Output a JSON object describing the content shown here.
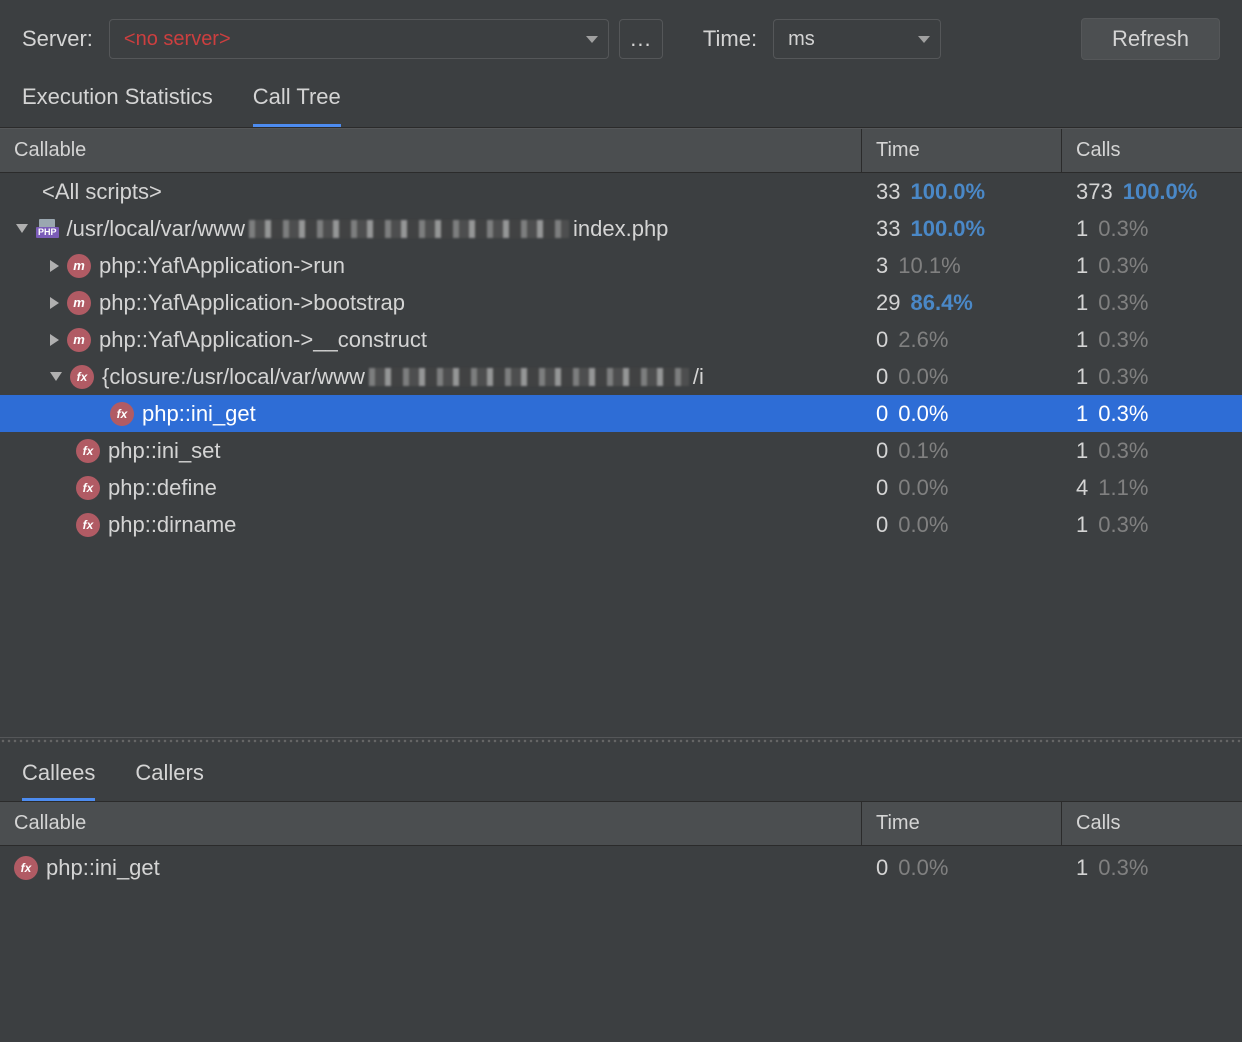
{
  "toolbar": {
    "server_label": "Server:",
    "server_value": "<no server>",
    "ellipsis": "...",
    "time_label": "Time:",
    "time_value": "ms",
    "refresh": "Refresh"
  },
  "tabs": {
    "exec_stats": "Execution Statistics",
    "call_tree": "Call Tree"
  },
  "columns": {
    "callable": "Callable",
    "time": "Time",
    "calls": "Calls"
  },
  "rows": [
    {
      "indent": 0,
      "tri": "none",
      "icon": "none",
      "label": "<All scripts>",
      "time_n": "33",
      "time_p": "100.0%",
      "time_hl": true,
      "calls_n": "373",
      "calls_p": "100.0%",
      "calls_hl": true
    },
    {
      "indent": 0,
      "tri": "open",
      "icon": "php",
      "label_pre": "/usr/local/var/www",
      "label_post": "index.php",
      "blur": true,
      "time_n": "33",
      "time_p": "100.0%",
      "time_hl": true,
      "calls_n": "1",
      "calls_p": "0.3%"
    },
    {
      "indent": 1,
      "tri": "closed",
      "icon": "m",
      "label": "php::Yaf\\Application->run",
      "time_n": "3",
      "time_p": "10.1%",
      "calls_n": "1",
      "calls_p": "0.3%"
    },
    {
      "indent": 1,
      "tri": "closed",
      "icon": "m",
      "label": "php::Yaf\\Application->bootstrap",
      "time_n": "29",
      "time_p": "86.4%",
      "time_hl": true,
      "calls_n": "1",
      "calls_p": "0.3%"
    },
    {
      "indent": 1,
      "tri": "closed",
      "icon": "m",
      "label": "php::Yaf\\Application->__construct",
      "time_n": "0",
      "time_p": "2.6%",
      "calls_n": "1",
      "calls_p": "0.3%"
    },
    {
      "indent": 1,
      "tri": "open",
      "icon": "fx",
      "label_pre": "{closure:/usr/local/var/www",
      "label_post": "/i",
      "blur": true,
      "time_n": "0",
      "time_p": "0.0%",
      "calls_n": "1",
      "calls_p": "0.3%"
    },
    {
      "indent": 2,
      "tri": "none",
      "icon": "fx",
      "label": "php::ini_get",
      "time_n": "0",
      "time_p": "0.0%",
      "calls_n": "1",
      "calls_p": "0.3%",
      "selected": true
    },
    {
      "indent": 1,
      "tri": "none",
      "icon": "fx",
      "label": "php::ini_set",
      "time_n": "0",
      "time_p": "0.1%",
      "calls_n": "1",
      "calls_p": "0.3%"
    },
    {
      "indent": 1,
      "tri": "none",
      "icon": "fx",
      "label": "php::define",
      "time_n": "0",
      "time_p": "0.0%",
      "calls_n": "4",
      "calls_p": "1.1%"
    },
    {
      "indent": 1,
      "tri": "none",
      "icon": "fx",
      "label": "php::dirname",
      "time_n": "0",
      "time_p": "0.0%",
      "calls_n": "1",
      "calls_p": "0.3%"
    }
  ],
  "bottom_tabs": {
    "callees": "Callees",
    "callers": "Callers"
  },
  "callee_row": {
    "label": "php::ini_get",
    "time_n": "0",
    "time_p": "0.0%",
    "calls_n": "1",
    "calls_p": "0.3%"
  }
}
